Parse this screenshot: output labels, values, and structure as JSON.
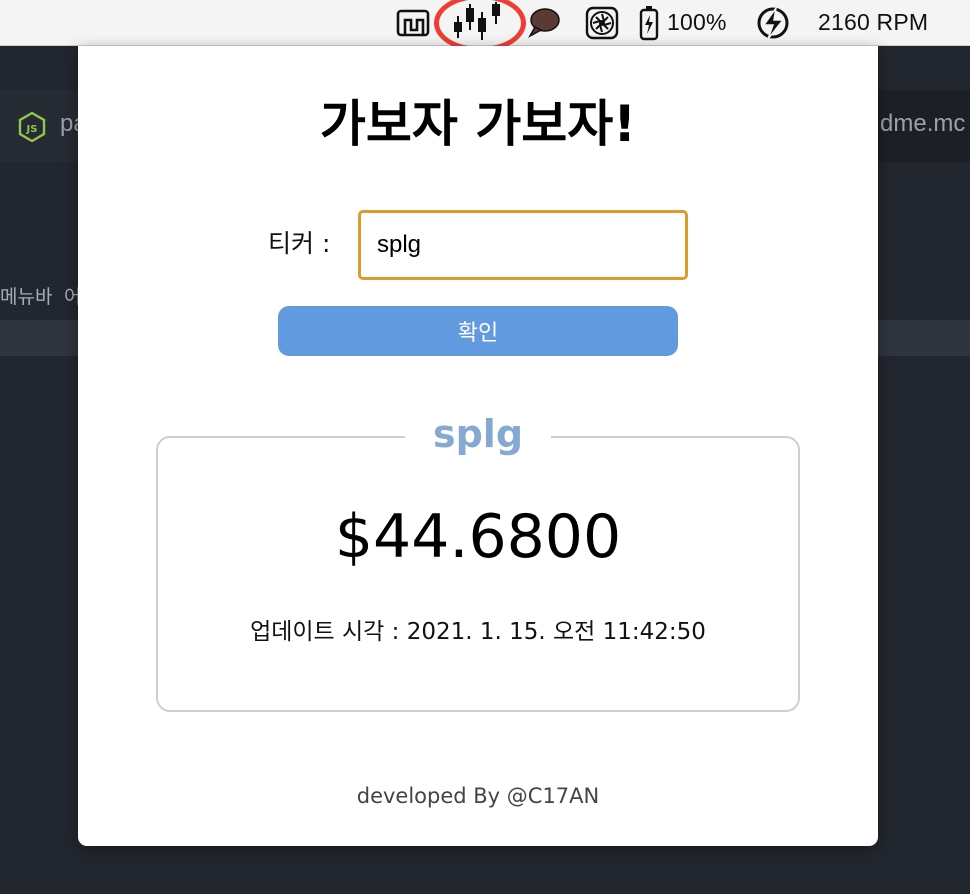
{
  "menubar": {
    "icons": [
      "dock-window-icon",
      "candlestick-chart-icon",
      "speech-bubble-icon",
      "fan-icon",
      "battery-charging-icon",
      "bolt-icon"
    ],
    "battery_label": "100%",
    "fan_speed_label": "2160 RPM",
    "highlight_color": "#ee3e33"
  },
  "editor": {
    "tab_left_partial": "pa",
    "tab_right_partial": "dme.mc",
    "menu_partial": "메뉴바",
    "menu_partial_2": "어"
  },
  "popup": {
    "title": "가보자 가보자!",
    "ticker_label": "티커 :",
    "ticker_value": "splg",
    "confirm_label": "확인",
    "result": {
      "ticker": "splg",
      "price": "$44.6800",
      "update_label": "업데이트 시각 : 2021. 1. 15. 오전 11:42:50"
    },
    "footer": "developed By @C17AN"
  },
  "colors": {
    "accent_button": "#629ae0",
    "input_border": "#e09a2a",
    "legend_text": "#86a9d2"
  }
}
